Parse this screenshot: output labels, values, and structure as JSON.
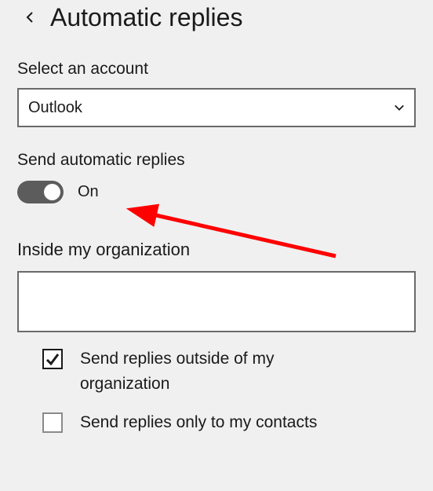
{
  "header": {
    "title": "Automatic replies"
  },
  "account": {
    "label": "Select an account",
    "selected": "Outlook"
  },
  "toggle": {
    "label": "Send automatic replies",
    "state_label": "On"
  },
  "inside_org": {
    "label": "Inside my organization",
    "value": ""
  },
  "options": {
    "outside_label": "Send replies outside of my organization",
    "contacts_label": "Send replies only to my contacts"
  },
  "annotation": {
    "color": "#ff0000"
  }
}
